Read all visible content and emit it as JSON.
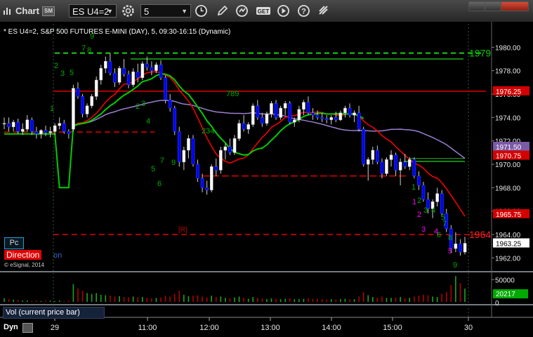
{
  "titlebar": {
    "title": "Chart",
    "link_badge": "SM",
    "symbol": "ES U4=2",
    "interval": "5",
    "icons": [
      "gear-icon",
      "clock-icon",
      "pencil-icon",
      "refresh-icon",
      "study-icon",
      "play-icon",
      "settings-icon"
    ]
  },
  "chart_info": "* ES U4=2, S&P 500 FUTURES E-MINI (DAY), 5, 09:30-16:15 (Dynamic)",
  "price_axis": {
    "ticks": [
      "1980.00",
      "1978.00",
      "1976.00",
      "1974.00",
      "1972.00",
      "1970.00",
      "1968.00",
      "1966.00",
      "1964.00",
      "1962.00"
    ],
    "labels": [
      {
        "text": "1979",
        "color": "#00cc00",
        "style": "plain"
      },
      {
        "text": "1976.25",
        "color": "#ffffff",
        "bg": "#d40000"
      },
      {
        "text": "1971.50",
        "color": "#ffffff",
        "bg": "#7b5aa6"
      },
      {
        "text": "1970.75",
        "color": "#ffffff",
        "bg": "#d40000"
      },
      {
        "text": "1965.75",
        "color": "#ffffff",
        "bg": "#d40000"
      },
      {
        "text": "1964",
        "color": "#ff2020",
        "style": "plain"
      },
      {
        "text": "1963.25",
        "color": "#000000",
        "bg": "#ffffff"
      }
    ]
  },
  "time_axis": [
    "29",
    "11:00",
    "12:00",
    "13:00",
    "14:00",
    "15:00",
    "30"
  ],
  "volume": {
    "label": "Vol (current price bar)",
    "ticks": [
      "50000",
      "0"
    ],
    "last_value": "20217",
    "last_color": "#00aa00"
  },
  "panel_labels": {
    "pc": "Pc",
    "direction": "Direction",
    "direction_suffix": "on",
    "copyright": "© eSignal, 2014",
    "dyn": "Dyn",
    "r_marker": "[R]"
  },
  "annotations": [
    {
      "t": "9",
      "c": "#00aa00"
    },
    {
      "t": "7",
      "c": "#00aa00"
    },
    {
      "t": "8",
      "c": "#00aa00"
    },
    {
      "t": "2",
      "c": "#00aa00"
    },
    {
      "t": "3",
      "c": "#00aa00"
    },
    {
      "t": "5",
      "c": "#00aa00"
    },
    {
      "t": "1",
      "c": "#00aa00"
    },
    {
      "t": "2",
      "c": "#00aa00"
    },
    {
      "t": "3",
      "c": "#00aa00"
    },
    {
      "t": "4",
      "c": "#00aa00"
    },
    {
      "t": "5",
      "c": "#00aa00"
    },
    {
      "t": "7",
      "c": "#00aa00"
    },
    {
      "t": "9",
      "c": "#00aa00"
    },
    {
      "t": "6",
      "c": "#00aa00"
    },
    {
      "t": "234",
      "c": "#00aa00"
    },
    {
      "t": "789",
      "c": "#00aa00"
    },
    {
      "t": "1",
      "c": "#00aa00"
    },
    {
      "t": "2",
      "c": "#00aa00"
    },
    {
      "t": "3",
      "c": "#00aa00"
    },
    {
      "t": "4",
      "c": "#00aa00"
    },
    {
      "t": "5",
      "c": "#00aa00"
    },
    {
      "t": "6",
      "c": "#00aa00"
    },
    {
      "t": "7",
      "c": "#00aa00"
    },
    {
      "t": "8",
      "c": "#00aa00"
    },
    {
      "t": "9",
      "c": "#00aa00"
    },
    {
      "t": "1",
      "c": "#ff00ff"
    },
    {
      "t": "2",
      "c": "#ff00ff"
    },
    {
      "t": "3",
      "c": "#ff00ff"
    },
    {
      "t": "4",
      "c": "#ff00ff"
    },
    {
      "t": "5",
      "c": "#ff00ff"
    }
  ],
  "colors": {
    "bull_candle": "#ffffff",
    "bear_candle": "#0000ff",
    "ma_fast": "#ff0000",
    "ma_slow": "#9b7fd0",
    "signal_line": "#00cc00",
    "background": "#000000"
  },
  "chart_data": {
    "type": "candlestick",
    "ylim": [
      1961.0,
      1982.0
    ],
    "candles": [
      [
        1973.5,
        1974.0,
        1973.0,
        1973.5
      ],
      [
        1973.5,
        1974.0,
        1972.8,
        1973.2
      ],
      [
        1973.2,
        1973.8,
        1972.8,
        1973.6
      ],
      [
        1973.6,
        1973.9,
        1972.6,
        1972.8
      ],
      [
        1972.8,
        1973.5,
        1972.5,
        1973.0
      ],
      [
        1973.0,
        1974.2,
        1972.8,
        1973.8
      ],
      [
        1973.8,
        1974.0,
        1972.5,
        1972.8
      ],
      [
        1972.8,
        1973.2,
        1972.2,
        1972.6
      ],
      [
        1972.6,
        1973.0,
        1972.2,
        1972.9
      ],
      [
        1972.9,
        1973.3,
        1972.4,
        1972.7
      ],
      [
        1972.7,
        1973.2,
        1972.3,
        1972.8
      ],
      [
        1972.8,
        1973.5,
        1972.5,
        1973.3
      ],
      [
        1973.3,
        1974.0,
        1973.0,
        1973.5
      ],
      [
        1973.5,
        1973.8,
        1972.6,
        1972.8
      ],
      [
        1972.8,
        1973.0,
        1972.2,
        1972.6
      ],
      [
        1973.0,
        1976.8,
        1972.8,
        1976.5
      ],
      [
        1976.5,
        1977.0,
        1975.6,
        1975.8
      ],
      [
        1975.8,
        1976.0,
        1974.0,
        1974.3
      ],
      [
        1974.3,
        1975.2,
        1974.0,
        1975.0
      ],
      [
        1975.0,
        1976.0,
        1974.8,
        1975.8
      ],
      [
        1975.8,
        1977.5,
        1975.5,
        1977.2
      ],
      [
        1977.2,
        1978.5,
        1976.8,
        1978.2
      ],
      [
        1978.2,
        1979.2,
        1977.8,
        1978.8
      ],
      [
        1978.8,
        1979.5,
        1977.6,
        1977.8
      ],
      [
        1977.8,
        1978.2,
        1976.6,
        1977.0
      ],
      [
        1977.0,
        1978.4,
        1976.8,
        1978.2
      ],
      [
        1978.2,
        1979.0,
        1977.5,
        1977.7
      ],
      [
        1977.7,
        1978.0,
        1976.5,
        1976.8
      ],
      [
        1976.8,
        1978.2,
        1976.6,
        1977.9
      ],
      [
        1977.9,
        1978.6,
        1977.0,
        1977.4
      ],
      [
        1977.4,
        1978.8,
        1977.2,
        1978.6
      ],
      [
        1978.6,
        1979.2,
        1978.0,
        1978.3
      ],
      [
        1978.3,
        1978.8,
        1977.6,
        1978.0
      ],
      [
        1978.0,
        1978.7,
        1977.8,
        1978.5
      ],
      [
        1978.5,
        1978.9,
        1977.2,
        1977.4
      ],
      [
        1977.4,
        1977.6,
        1975.2,
        1975.5
      ],
      [
        1975.5,
        1976.0,
        1974.5,
        1974.8
      ],
      [
        1974.8,
        1975.0,
        1972.5,
        1972.8
      ],
      [
        1972.8,
        1973.2,
        1969.8,
        1970.2
      ],
      [
        1970.2,
        1971.5,
        1969.5,
        1971.2
      ],
      [
        1971.2,
        1972.5,
        1970.5,
        1972.2
      ],
      [
        1972.2,
        1972.5,
        1969.8,
        1970.0
      ],
      [
        1970.0,
        1970.4,
        1968.5,
        1968.8
      ],
      [
        1968.8,
        1969.2,
        1967.6,
        1968.0
      ],
      [
        1968.0,
        1968.6,
        1967.4,
        1967.8
      ],
      [
        1967.8,
        1970.0,
        1967.6,
        1969.8
      ],
      [
        1969.8,
        1970.5,
        1969.0,
        1969.5
      ],
      [
        1969.5,
        1971.5,
        1969.2,
        1971.2
      ],
      [
        1971.2,
        1971.8,
        1970.4,
        1971.5
      ],
      [
        1971.5,
        1972.2,
        1970.8,
        1971.0
      ],
      [
        1971.0,
        1972.5,
        1970.8,
        1972.2
      ],
      [
        1972.2,
        1973.8,
        1972.0,
        1973.5
      ],
      [
        1973.5,
        1974.2,
        1972.8,
        1973.0
      ],
      [
        1973.0,
        1973.6,
        1972.6,
        1973.4
      ],
      [
        1973.4,
        1975.2,
        1973.2,
        1975.0
      ],
      [
        1975.0,
        1975.5,
        1973.8,
        1974.0
      ],
      [
        1974.0,
        1974.4,
        1973.2,
        1973.5
      ],
      [
        1973.5,
        1974.5,
        1973.3,
        1974.3
      ],
      [
        1974.3,
        1975.4,
        1974.0,
        1975.2
      ],
      [
        1975.2,
        1975.5,
        1973.8,
        1974.0
      ],
      [
        1974.0,
        1975.0,
        1973.8,
        1974.8
      ],
      [
        1974.8,
        1975.4,
        1974.2,
        1975.2
      ],
      [
        1975.2,
        1975.4,
        1973.4,
        1973.6
      ],
      [
        1973.6,
        1974.0,
        1973.2,
        1973.8
      ],
      [
        1973.8,
        1975.0,
        1973.6,
        1974.7
      ],
      [
        1974.7,
        1975.5,
        1974.2,
        1975.3
      ],
      [
        1975.3,
        1975.8,
        1974.2,
        1974.4
      ],
      [
        1974.4,
        1974.8,
        1973.8,
        1974.2
      ],
      [
        1974.2,
        1974.6,
        1973.8,
        1974.0
      ],
      [
        1974.0,
        1974.4,
        1973.6,
        1973.9
      ],
      [
        1973.9,
        1974.2,
        1973.5,
        1973.8
      ],
      [
        1973.8,
        1974.2,
        1973.4,
        1974.0
      ],
      [
        1974.0,
        1974.5,
        1973.6,
        1973.8
      ],
      [
        1973.8,
        1974.6,
        1973.7,
        1974.4
      ],
      [
        1974.4,
        1975.0,
        1974.0,
        1974.8
      ],
      [
        1974.8,
        1975.2,
        1974.0,
        1974.2
      ],
      [
        1974.2,
        1974.6,
        1973.6,
        1974.4
      ],
      [
        1974.4,
        1975.0,
        1972.8,
        1973.0
      ],
      [
        1973.0,
        1973.2,
        1969.8,
        1970.0
      ],
      [
        1970.0,
        1970.6,
        1968.6,
        1970.4
      ],
      [
        1970.4,
        1971.5,
        1970.0,
        1971.2
      ],
      [
        1971.2,
        1971.6,
        1970.0,
        1970.2
      ],
      [
        1970.2,
        1970.5,
        1968.8,
        1969.2
      ],
      [
        1969.2,
        1970.6,
        1969.0,
        1970.4
      ],
      [
        1970.4,
        1971.2,
        1969.8,
        1970.8
      ],
      [
        1970.8,
        1971.0,
        1969.0,
        1969.5
      ],
      [
        1969.5,
        1970.5,
        1968.2,
        1970.2
      ],
      [
        1970.2,
        1970.9,
        1969.6,
        1969.8
      ],
      [
        1969.8,
        1970.6,
        1969.5,
        1970.4
      ],
      [
        1970.4,
        1970.6,
        1968.8,
        1969.0
      ],
      [
        1969.0,
        1969.4,
        1967.8,
        1968.2
      ],
      [
        1968.2,
        1968.5,
        1966.8,
        1967.0
      ],
      [
        1967.0,
        1967.6,
        1965.8,
        1966.2
      ],
      [
        1966.2,
        1967.0,
        1965.4,
        1966.8
      ],
      [
        1966.8,
        1968.0,
        1966.4,
        1967.5
      ],
      [
        1967.5,
        1967.8,
        1965.5,
        1965.8
      ],
      [
        1965.8,
        1966.2,
        1964.2,
        1964.5
      ],
      [
        1964.5,
        1964.8,
        1962.4,
        1962.8
      ],
      [
        1962.8,
        1964.2,
        1962.5,
        1963.2
      ],
      [
        1963.2,
        1963.6,
        1962.2,
        1962.5
      ],
      [
        1962.5,
        1963.8,
        1962.3,
        1963.25
      ]
    ],
    "volume": [
      8000,
      6000,
      5000,
      4000,
      3000,
      3000,
      2000,
      3000,
      2000,
      3000,
      3000,
      2000,
      3000,
      2000,
      3000,
      40000,
      30000,
      25000,
      20000,
      18000,
      20000,
      16000,
      15000,
      14000,
      12000,
      13000,
      11000,
      10000,
      12000,
      10000,
      11000,
      9000,
      8000,
      9000,
      10000,
      14000,
      12000,
      18000,
      25000,
      16000,
      13000,
      14000,
      15000,
      12000,
      10000,
      14000,
      11000,
      12000,
      9000,
      8000,
      10000,
      12000,
      9000,
      7000,
      11000,
      9000,
      7000,
      6000,
      8000,
      7000,
      6000,
      7000,
      8000,
      6000,
      6000,
      7000,
      8000,
      7000,
      6000,
      6000,
      5000,
      6000,
      5000,
      6000,
      7000,
      6000,
      6000,
      12000,
      22000,
      15000,
      11000,
      10000,
      12000,
      9000,
      9000,
      10000,
      11000,
      8000,
      9000,
      12000,
      14000,
      16000,
      15000,
      12000,
      11000,
      18000,
      22000,
      38000,
      58000,
      42000,
      30000
    ],
    "x_ticks": [
      "29",
      "11:00",
      "12:00",
      "13:00",
      "14:00",
      "15:00",
      "30"
    ],
    "levels": [
      1979.0,
      1976.25,
      1964.0
    ]
  }
}
